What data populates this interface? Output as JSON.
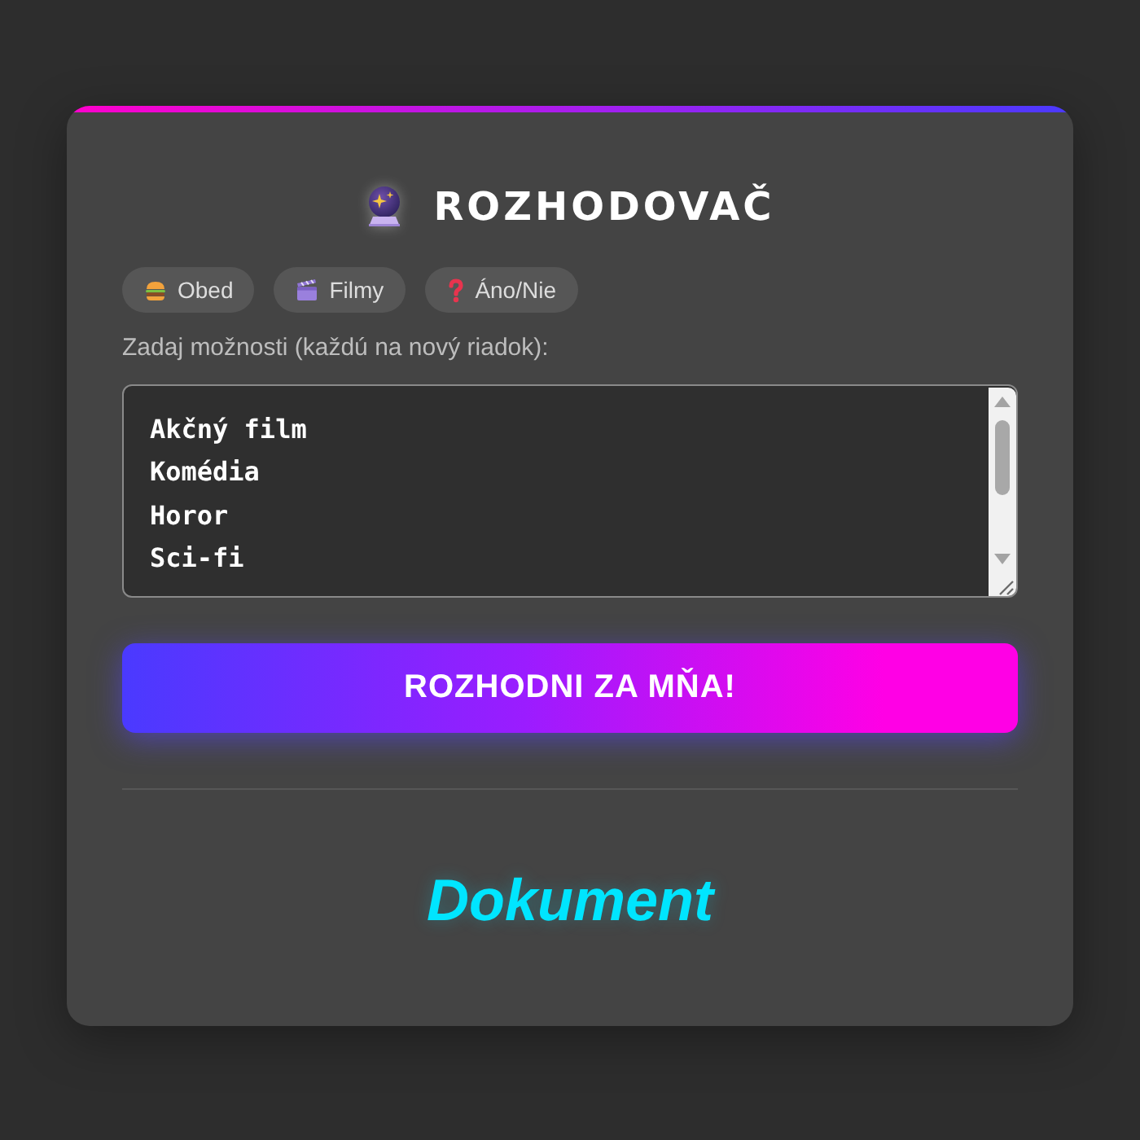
{
  "app": {
    "title": "ROZHODOVAČ"
  },
  "presets": [
    {
      "kind": "food",
      "label": "Obed"
    },
    {
      "kind": "movie",
      "label": "Filmy"
    },
    {
      "kind": "question",
      "label": "Áno/Nie"
    }
  ],
  "options": {
    "label": "Zadaj možnosti (každú na nový riadok):",
    "value": "Akčný film\nKomédia\nHoror\nSci-fi"
  },
  "decide_button": {
    "label": "ROZHODNI ZA MŇA!"
  },
  "result": {
    "text": "Dokument"
  }
}
